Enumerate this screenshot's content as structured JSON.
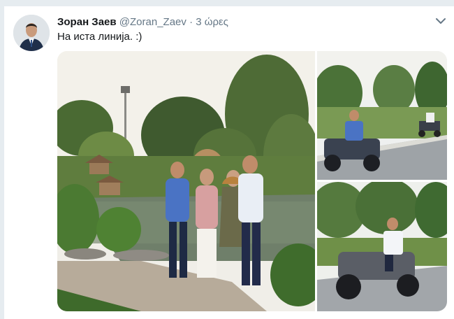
{
  "tweet": {
    "author_name": "Зоран Заев",
    "handle": "@Zoran_Zaev",
    "separator": "·",
    "time": "3 ώρες",
    "text": "На иста линија. :)"
  },
  "icons": {
    "menu": "chevron-down-icon"
  },
  "colors": {
    "name": "#14171a",
    "secondary": "#657786",
    "background": "#e6ecf0"
  }
}
